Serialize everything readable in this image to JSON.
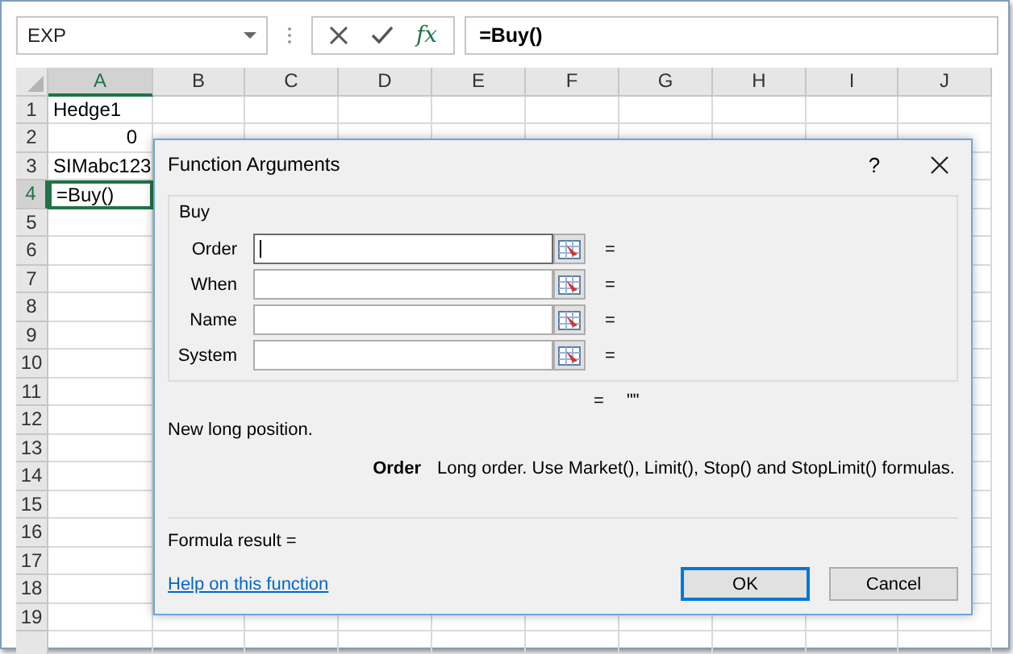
{
  "name_box": {
    "value": "EXP"
  },
  "formula_bar": {
    "fx": "fx",
    "value": "=Buy()"
  },
  "sheet": {
    "columns": [
      {
        "label": "A",
        "selected": true
      },
      {
        "label": "B",
        "selected": false
      },
      {
        "label": "C",
        "selected": false
      },
      {
        "label": "D",
        "selected": false
      },
      {
        "label": "E",
        "selected": false
      },
      {
        "label": "F",
        "selected": false
      },
      {
        "label": "G",
        "selected": false
      },
      {
        "label": "H",
        "selected": false
      },
      {
        "label": "I",
        "selected": false
      },
      {
        "label": "J",
        "selected": false
      }
    ],
    "rows": [
      {
        "label": "1",
        "selected": false,
        "cell": {
          "text": "Hedge1",
          "kind": "text",
          "selected": false
        }
      },
      {
        "label": "2",
        "selected": false,
        "cell": {
          "text": "0",
          "kind": "number",
          "selected": false
        }
      },
      {
        "label": "3",
        "selected": false,
        "cell": {
          "text": "SIMabc123",
          "kind": "text",
          "selected": false
        }
      },
      {
        "label": "4",
        "selected": true,
        "cell": {
          "text": "=Buy()",
          "kind": "text",
          "selected": true
        }
      },
      {
        "label": "5",
        "selected": false
      },
      {
        "label": "6",
        "selected": false
      },
      {
        "label": "7",
        "selected": false
      },
      {
        "label": "8",
        "selected": false
      },
      {
        "label": "9",
        "selected": false
      },
      {
        "label": "10",
        "selected": false
      },
      {
        "label": "11",
        "selected": false
      },
      {
        "label": "12",
        "selected": false
      },
      {
        "label": "13",
        "selected": false
      },
      {
        "label": "14",
        "selected": false
      },
      {
        "label": "15",
        "selected": false
      },
      {
        "label": "16",
        "selected": false
      },
      {
        "label": "17",
        "selected": false
      },
      {
        "label": "18",
        "selected": false
      },
      {
        "label": "19",
        "selected": false
      }
    ]
  },
  "dialog": {
    "title": "Function Arguments",
    "help": "?",
    "group": "Buy",
    "arguments": [
      {
        "label": "Order",
        "equals": "=",
        "focused": true
      },
      {
        "label": "When",
        "equals": "=",
        "focused": false
      },
      {
        "label": "Name",
        "equals": "=",
        "focused": false
      },
      {
        "label": "System",
        "equals": "=",
        "focused": false
      }
    ],
    "result_equals": "=",
    "result_value": "\"\"",
    "description": "New long position.",
    "argument_help": {
      "name": "Order",
      "text": "Long order. Use Market(), Limit(), Stop() and StopLimit() formulas."
    },
    "formula_result": "Formula result =",
    "help_link": "Help on this function",
    "buttons": [
      {
        "label": "OK",
        "default": true
      },
      {
        "label": "Cancel",
        "default": false
      }
    ]
  }
}
